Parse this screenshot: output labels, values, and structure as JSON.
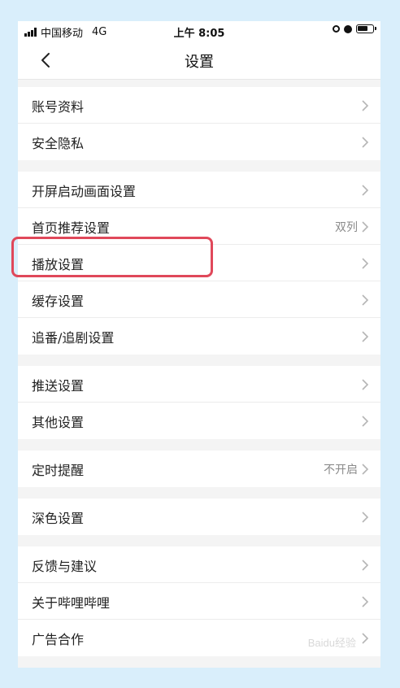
{
  "status_bar": {
    "carrier": "中国移动",
    "network": "4G",
    "time": "上午 8:05"
  },
  "header": {
    "title": "设置",
    "back_icon": "chevron-left-icon"
  },
  "groups": [
    {
      "items": [
        {
          "label": "账号资料",
          "value": ""
        },
        {
          "label": "安全隐私",
          "value": ""
        }
      ]
    },
    {
      "items": [
        {
          "label": "开屏启动画面设置",
          "value": ""
        },
        {
          "label": "首页推荐设置",
          "value": "双列"
        },
        {
          "label": "播放设置",
          "value": ""
        },
        {
          "label": "缓存设置",
          "value": ""
        },
        {
          "label": "追番/追剧设置",
          "value": ""
        }
      ]
    },
    {
      "items": [
        {
          "label": "推送设置",
          "value": ""
        },
        {
          "label": "其他设置",
          "value": ""
        }
      ]
    },
    {
      "items": [
        {
          "label": "定时提醒",
          "value": "不开启"
        }
      ]
    },
    {
      "items": [
        {
          "label": "深色设置",
          "value": ""
        }
      ]
    },
    {
      "items": [
        {
          "label": "反馈与建议",
          "value": ""
        },
        {
          "label": "关于哔哩哔哩",
          "value": ""
        },
        {
          "label": "广告合作",
          "value": ""
        }
      ]
    }
  ],
  "highlight_color": "#e0485a",
  "watermark": "Baidu经验"
}
